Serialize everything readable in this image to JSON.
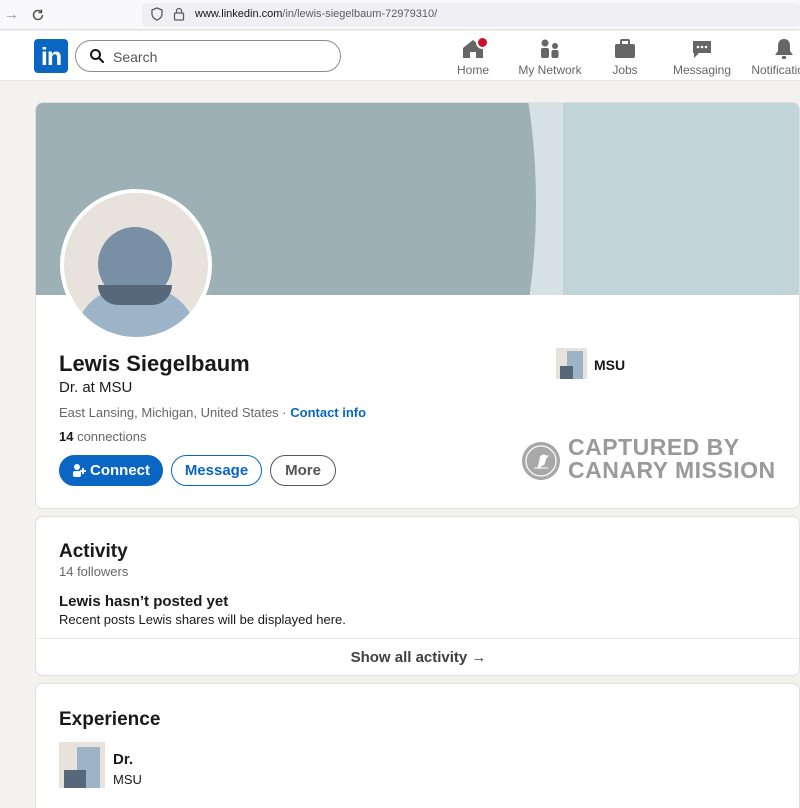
{
  "browser": {
    "url_domain": "www.linkedin.com",
    "url_path": "/in/lewis-siegelbaum-72979310/"
  },
  "header": {
    "logo": "in",
    "search_placeholder": "Search",
    "nav": [
      {
        "label": "Home",
        "icon": "home-icon"
      },
      {
        "label": "My Network",
        "icon": "network-icon"
      },
      {
        "label": "Jobs",
        "icon": "briefcase-icon"
      },
      {
        "label": "Messaging",
        "icon": "chat-icon"
      },
      {
        "label": "Notifications",
        "icon": "bell-icon"
      }
    ]
  },
  "profile": {
    "name": "Lewis Siegelbaum",
    "headline": "Dr. at MSU",
    "location": "East Lansing, Michigan, United States",
    "separator": " · ",
    "contact_label": "Contact info",
    "connections_count": "14",
    "connections_label": " connections",
    "buttons": {
      "connect": "Connect",
      "message": "Message",
      "more": "More"
    },
    "education": "MSU"
  },
  "watermark": {
    "line1": "CAPTURED BY",
    "line2": "CANARY MISSION"
  },
  "activity": {
    "title": "Activity",
    "followers": "14 followers",
    "empty_title": "Lewis hasn’t posted yet",
    "empty_sub": "Recent posts Lewis shares will be displayed here.",
    "show_all": "Show all activity →"
  },
  "experience": {
    "title": "Experience",
    "items": [
      {
        "role": "Dr.",
        "org": "MSU"
      }
    ]
  },
  "colors": {
    "brand": "#0a66c2",
    "badge": "#cb112d",
    "page_bg": "#f4f2ee"
  }
}
